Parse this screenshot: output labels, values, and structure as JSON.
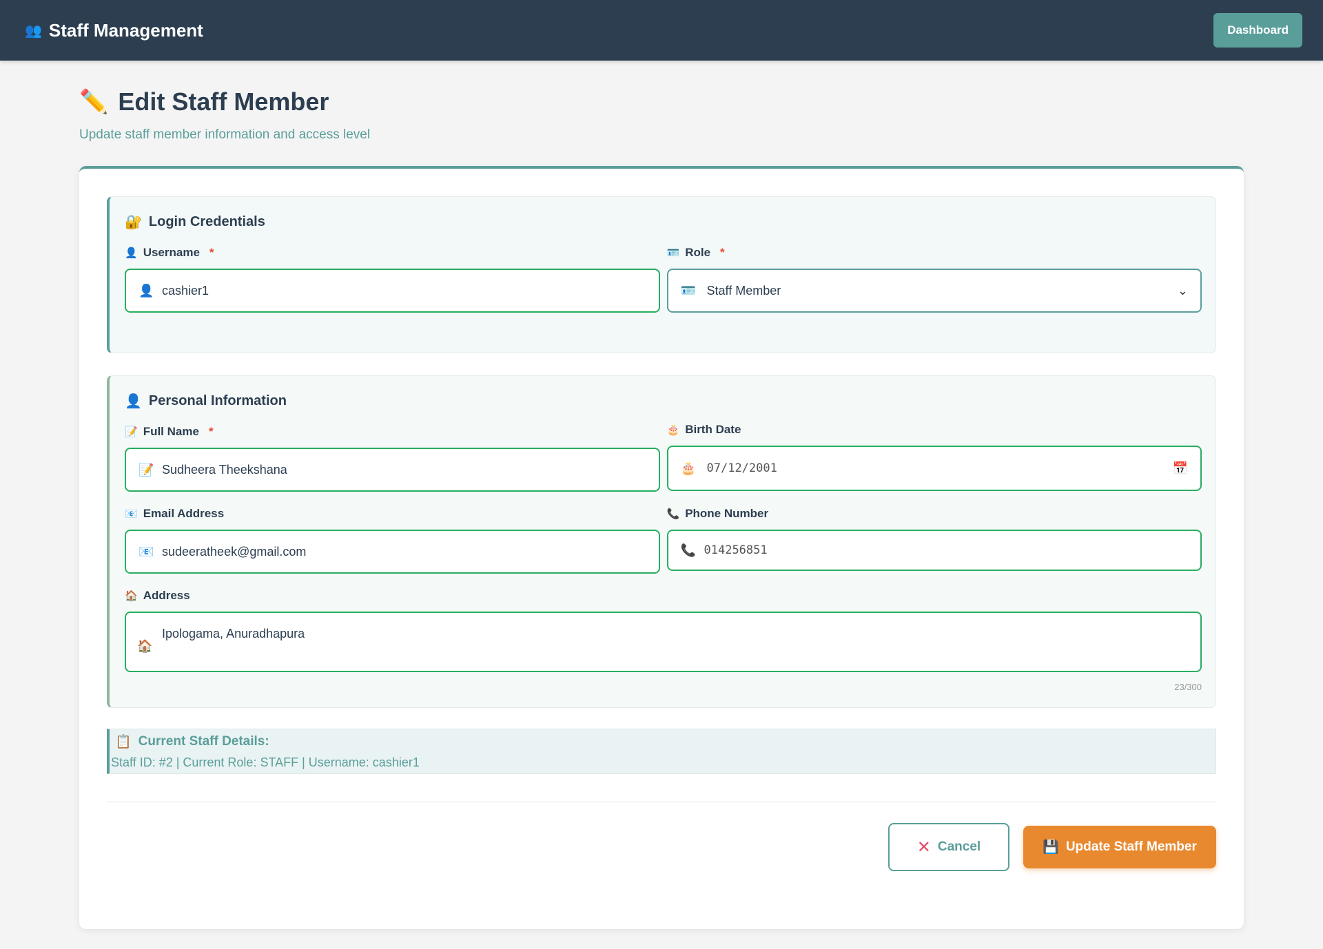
{
  "navbar": {
    "brand_icon": "people-icon",
    "brand": "Staff Management",
    "dashboard": "Dashboard"
  },
  "header": {
    "icon": "pencil-icon",
    "title": "Edit Staff Member",
    "subtitle": "Update staff member information and access level"
  },
  "login_section": {
    "title": "Login Credentials",
    "icon": "lock-icon",
    "username": {
      "label": "Username",
      "required": "*",
      "value": "cashier1",
      "icon": "user-icon"
    },
    "role": {
      "label": "Role",
      "required": "*",
      "value": "Staff Member",
      "icon": "id-card-icon"
    }
  },
  "personal_section": {
    "title": "Personal Information",
    "icon": "user-icon",
    "full_name": {
      "label": "Full Name",
      "required": "*",
      "value": "Sudheera Theekshana",
      "icon": "memo-icon"
    },
    "birth_date": {
      "label": "Birth Date",
      "value": "07/12/2001",
      "icon": "cake-icon"
    },
    "email": {
      "label": "Email Address",
      "value": "sudeeratheek@gmail.com",
      "icon": "email-icon"
    },
    "phone": {
      "label": "Phone Number",
      "value": "014256851",
      "icon": "phone-icon"
    },
    "address": {
      "label": "Address",
      "value": "Ipologama, Anuradhapura",
      "icon": "house-icon",
      "counter": "23/300"
    }
  },
  "details": {
    "title": "Current Staff Details:",
    "text": "Staff ID: #2 | Current Role: STAFF | Username: cashier1",
    "icon": "clipboard-icon"
  },
  "actions": {
    "cancel": "Cancel",
    "update": "Update Staff Member"
  },
  "colors": {
    "navbar": "#2c3e50",
    "accent": "#5a9e9a",
    "input_border": "#27ae60",
    "update_button": "#e9892f",
    "required": "#e74c3c"
  }
}
